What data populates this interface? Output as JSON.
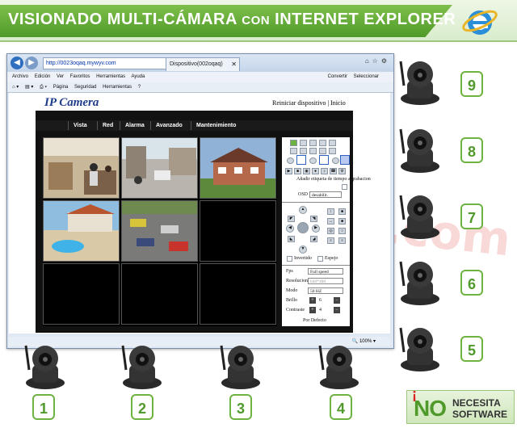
{
  "banner": {
    "title_part1": "VISIONADO MULTI-CÁMARA ",
    "title_part2": "CON",
    "title_part3": " INTERNET EXPLORER"
  },
  "watermark": "superinventos.com",
  "browser": {
    "address": "http://0023oqaq.mywyv.com",
    "tab_title": "Dispositivo(002oqaq)",
    "menu": [
      "Archivo",
      "Edición",
      "Ver",
      "Favoritos",
      "Herramientas",
      "Ayuda"
    ],
    "menu_right": [
      "Convertir",
      "Seleccionar"
    ],
    "command_bar": [
      "Página",
      "Seguridad",
      "Herramientas"
    ],
    "zoom": "100%"
  },
  "page": {
    "logo": "IP Camera",
    "top_links": "Reiniciar dispositivo | Inicio",
    "nav": [
      "Vista",
      "Red",
      "Alarma",
      "Avanzado",
      "Mantenimiento"
    ],
    "controls": {
      "timestamp_label": "Añadir etiqueta de tiempo a grabacion",
      "osd_label": "OSD",
      "osd_value": "desabilit.",
      "invert_label": "Invertido",
      "mirror_label": "Espejo",
      "fps_label": "Fps",
      "fps_value": "Full speed",
      "resolution_label": "Resolucion",
      "resolution_value": "640*480",
      "mode_label": "Modo",
      "mode_value": "50 HZ",
      "brightness_label": "Brillo",
      "brightness_value": "6",
      "contrast_label": "Contraste",
      "contrast_value": "4",
      "default_label": "Por Defecto"
    }
  },
  "camera_numbers": [
    "1",
    "2",
    "3",
    "4",
    "5",
    "6",
    "7",
    "8",
    "9"
  ],
  "badge": {
    "no": "NO",
    "line1": "NECESITA",
    "line2": "SOFTWARE"
  },
  "colors": {
    "brand_green": "#4f9a2a",
    "watermark_red": "#dc2828"
  }
}
